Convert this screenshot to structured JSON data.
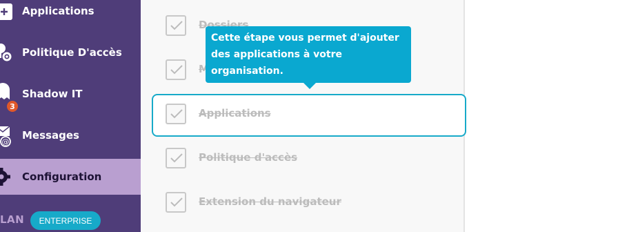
{
  "sidebar": {
    "items": [
      {
        "label": "Applications",
        "icon": "plus-icon",
        "active": false
      },
      {
        "label": "Politique D'accès",
        "icon": "key-gear-icon",
        "active": false
      },
      {
        "label": "Shadow IT",
        "icon": "ghost-icon",
        "active": false,
        "badge": "3"
      },
      {
        "label": "Messages",
        "icon": "mail-at-icon",
        "active": false
      },
      {
        "label": "Configuration",
        "icon": "gear-icon",
        "active": true
      }
    ],
    "plan_label": "LAN",
    "plan_badge": "ENTERPRISE"
  },
  "steps": [
    {
      "label": "Dossiers",
      "completed": true
    },
    {
      "label": "M",
      "completed": true
    },
    {
      "label": "Applications",
      "completed": true,
      "highlighted": true
    },
    {
      "label": "Politique d'accès",
      "completed": true
    },
    {
      "label": "Extension du navigateur",
      "completed": true
    }
  ],
  "tooltip": {
    "text": "Cette étape vous permet d'ajouter des applications à votre organisation."
  },
  "colors": {
    "sidebar_bg": "#4f3d79",
    "active_item_bg": "#b99fd0",
    "accent": "#17aac9",
    "badge": "#e0582a"
  }
}
